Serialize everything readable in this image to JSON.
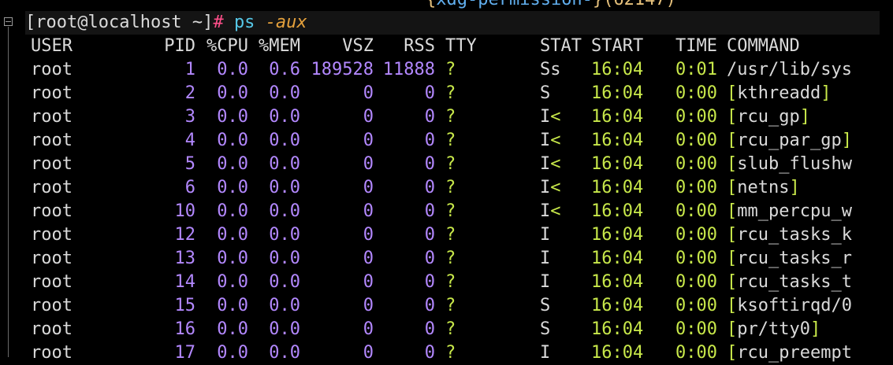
{
  "previous_line": {
    "open": "{",
    "name": "xdg-permission-",
    "close": "}",
    "pid": "(62147)"
  },
  "prompt": {
    "open_bracket": "[",
    "user_host": "root@localhost",
    "cwd": " ~",
    "close_bracket": "]",
    "symbol": "#",
    "command": "ps",
    "args": "-aux"
  },
  "headers": {
    "user": "USER",
    "pid": "PID",
    "cpu": "%CPU",
    "mem": "%MEM",
    "vsz": "VSZ",
    "rss": "RSS",
    "tty": "TTY",
    "stat": "STAT",
    "start": "START",
    "time": "TIME",
    "command": "COMMAND"
  },
  "rows": [
    {
      "user": "root",
      "pid": "1",
      "cpu": "0.0",
      "mem": "0.6",
      "vsz": "189528",
      "rss": "11888",
      "tty": "?",
      "stat": "Ss",
      "stat_flag": "",
      "start": "16:04",
      "time": "0:01",
      "cmd_open": "",
      "cmd": "/usr/lib/sys",
      "cmd_close": ""
    },
    {
      "user": "root",
      "pid": "2",
      "cpu": "0.0",
      "mem": "0.0",
      "vsz": "0",
      "rss": "0",
      "tty": "?",
      "stat": "S",
      "stat_flag": "",
      "start": "16:04",
      "time": "0:00",
      "cmd_open": "[",
      "cmd": "kthreadd",
      "cmd_close": "]"
    },
    {
      "user": "root",
      "pid": "3",
      "cpu": "0.0",
      "mem": "0.0",
      "vsz": "0",
      "rss": "0",
      "tty": "?",
      "stat": "I",
      "stat_flag": "<",
      "start": "16:04",
      "time": "0:00",
      "cmd_open": "[",
      "cmd": "rcu_gp",
      "cmd_close": "]"
    },
    {
      "user": "root",
      "pid": "4",
      "cpu": "0.0",
      "mem": "0.0",
      "vsz": "0",
      "rss": "0",
      "tty": "?",
      "stat": "I",
      "stat_flag": "<",
      "start": "16:04",
      "time": "0:00",
      "cmd_open": "[",
      "cmd": "rcu_par_gp",
      "cmd_close": "]"
    },
    {
      "user": "root",
      "pid": "5",
      "cpu": "0.0",
      "mem": "0.0",
      "vsz": "0",
      "rss": "0",
      "tty": "?",
      "stat": "I",
      "stat_flag": "<",
      "start": "16:04",
      "time": "0:00",
      "cmd_open": "[",
      "cmd": "slub_flushw",
      "cmd_close": ""
    },
    {
      "user": "root",
      "pid": "6",
      "cpu": "0.0",
      "mem": "0.0",
      "vsz": "0",
      "rss": "0",
      "tty": "?",
      "stat": "I",
      "stat_flag": "<",
      "start": "16:04",
      "time": "0:00",
      "cmd_open": "[",
      "cmd": "netns",
      "cmd_close": "]"
    },
    {
      "user": "root",
      "pid": "10",
      "cpu": "0.0",
      "mem": "0.0",
      "vsz": "0",
      "rss": "0",
      "tty": "?",
      "stat": "I",
      "stat_flag": "<",
      "start": "16:04",
      "time": "0:00",
      "cmd_open": "[",
      "cmd": "mm_percpu_w",
      "cmd_close": ""
    },
    {
      "user": "root",
      "pid": "12",
      "cpu": "0.0",
      "mem": "0.0",
      "vsz": "0",
      "rss": "0",
      "tty": "?",
      "stat": "I",
      "stat_flag": "",
      "start": "16:04",
      "time": "0:00",
      "cmd_open": "[",
      "cmd": "rcu_tasks_k",
      "cmd_close": ""
    },
    {
      "user": "root",
      "pid": "13",
      "cpu": "0.0",
      "mem": "0.0",
      "vsz": "0",
      "rss": "0",
      "tty": "?",
      "stat": "I",
      "stat_flag": "",
      "start": "16:04",
      "time": "0:00",
      "cmd_open": "[",
      "cmd": "rcu_tasks_r",
      "cmd_close": ""
    },
    {
      "user": "root",
      "pid": "14",
      "cpu": "0.0",
      "mem": "0.0",
      "vsz": "0",
      "rss": "0",
      "tty": "?",
      "stat": "I",
      "stat_flag": "",
      "start": "16:04",
      "time": "0:00",
      "cmd_open": "[",
      "cmd": "rcu_tasks_t",
      "cmd_close": ""
    },
    {
      "user": "root",
      "pid": "15",
      "cpu": "0.0",
      "mem": "0.0",
      "vsz": "0",
      "rss": "0",
      "tty": "?",
      "stat": "S",
      "stat_flag": "",
      "start": "16:04",
      "time": "0:00",
      "cmd_open": "[",
      "cmd": "ksoftirqd/0",
      "cmd_close": ""
    },
    {
      "user": "root",
      "pid": "16",
      "cpu": "0.0",
      "mem": "0.0",
      "vsz": "0",
      "rss": "0",
      "tty": "?",
      "stat": "S",
      "stat_flag": "",
      "start": "16:04",
      "time": "0:00",
      "cmd_open": "[",
      "cmd": "pr/tty0",
      "cmd_close": "]"
    },
    {
      "user": "root",
      "pid": "17",
      "cpu": "0.0",
      "mem": "0.0",
      "vsz": "0",
      "rss": "0",
      "tty": "?",
      "stat": "I",
      "stat_flag": "",
      "start": "16:04",
      "time": "0:00",
      "cmd_open": "[",
      "cmd": "rcu_preempt",
      "cmd_close": ""
    }
  ]
}
